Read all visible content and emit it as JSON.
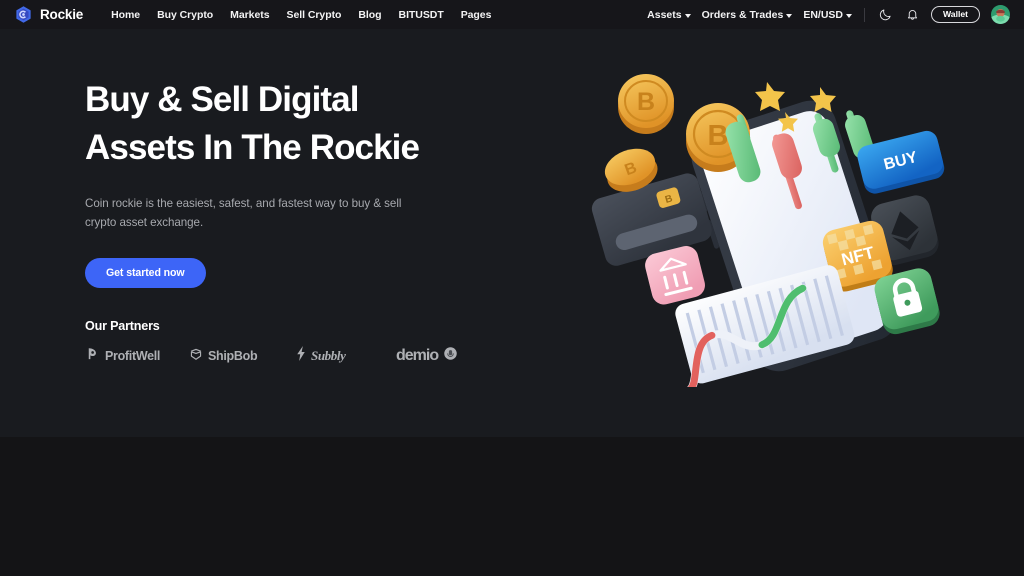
{
  "navbar": {
    "brand": {
      "name": "Rockie",
      "icon": "rockie-hexagon-logo",
      "color": "#4169e8"
    },
    "links": [
      {
        "label": "Home"
      },
      {
        "label": "Buy Crypto"
      },
      {
        "label": "Markets"
      },
      {
        "label": "Sell Crypto"
      },
      {
        "label": "Blog"
      },
      {
        "label": "BITUSDT"
      },
      {
        "label": "Pages"
      }
    ],
    "right": {
      "assets": "Assets",
      "orders_trades": "Orders & Trades",
      "currency": "EN/USD",
      "theme_icon": "moon-icon",
      "notification_icon": "bell-icon",
      "wallet_label": "Wallet",
      "avatar_icon": "user-avatar"
    }
  },
  "hero": {
    "title_line1": "Buy & Sell Digital",
    "title_line2": "Assets In The Rockie",
    "subtitle": "Coin rockie is the easiest, safest, and fastest way to buy & sell crypto asset exchange.",
    "cta_label": "Get started now",
    "background": "#191b1f",
    "accent": "#3d65f7"
  },
  "partners": {
    "heading": "Our Partners",
    "items": [
      {
        "name": "ProfitWell",
        "icon": "profitwell-logo"
      },
      {
        "name": "ShipBob",
        "icon": "shipbob-logo"
      },
      {
        "name": "Subbly",
        "icon": "subbly-logo"
      },
      {
        "name": "demio",
        "icon": "demio-logo"
      }
    ]
  },
  "illustration": {
    "name": "crypto-trading-3d-illustration",
    "elements": [
      {
        "label": "BUY",
        "kind": "button-tile",
        "color": "#1a7fdc"
      },
      {
        "label": "NFT",
        "kind": "tile",
        "color": "#f0ad3e"
      },
      {
        "label": "",
        "kind": "ethereum-tile",
        "color": "#3a3f46"
      },
      {
        "label": "",
        "kind": "lock-tile",
        "color": "#5cb874"
      },
      {
        "label": "",
        "kind": "bank-tile",
        "color": "#f3b6c4"
      },
      {
        "label": "",
        "kind": "credit-card",
        "color": "#41464f"
      },
      {
        "label": "",
        "kind": "smartphone",
        "color": "#2c313a"
      },
      {
        "label": "",
        "kind": "bitcoin-coin",
        "color": "#eda93c"
      },
      {
        "label": "",
        "kind": "star",
        "color": "#f5c242"
      },
      {
        "label": "",
        "kind": "candlestick-green",
        "color": "#79d394"
      },
      {
        "label": "",
        "kind": "candlestick-red",
        "color": "#ea7b78"
      },
      {
        "label": "",
        "kind": "line-chart-card",
        "color": "#eef1f8"
      }
    ]
  }
}
